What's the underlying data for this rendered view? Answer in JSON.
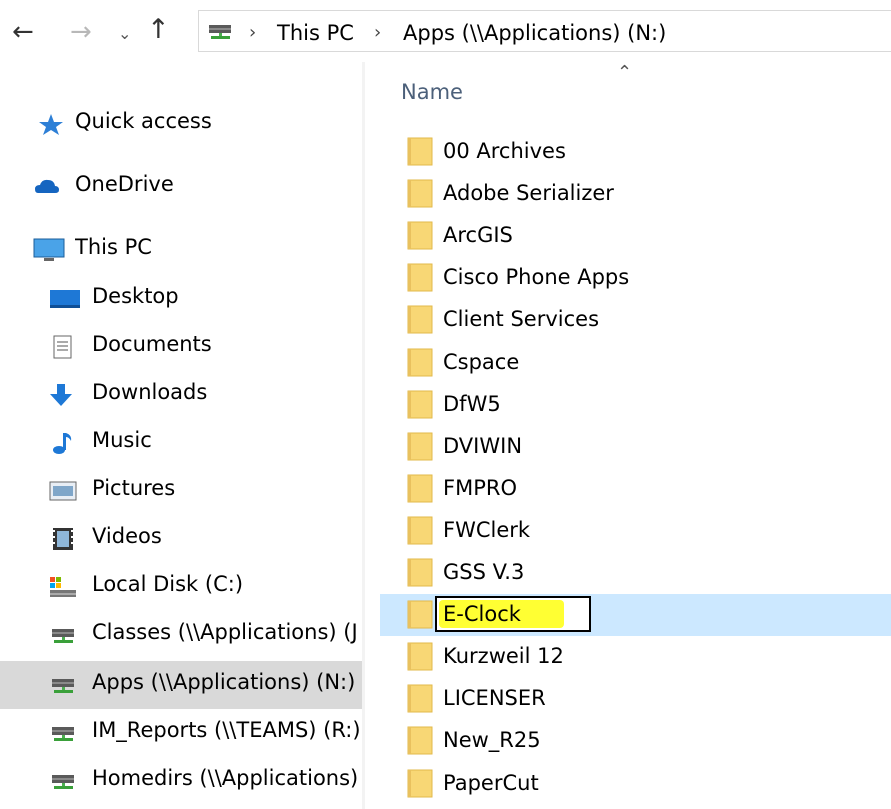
{
  "address_bar": {
    "back_icon": "arrow-left-icon",
    "forward_icon": "arrow-right-icon",
    "recent_icon": "chevron-down-icon",
    "up_icon": "arrow-up-icon",
    "drive_icon": "network-drive-icon",
    "breadcrumbs": [
      "This PC",
      "Apps (\\\\Applications) (N:)"
    ]
  },
  "nav_pane": {
    "items": [
      {
        "label": "Quick access",
        "icon": "star-icon"
      },
      {
        "label": "OneDrive",
        "icon": "cloud-icon"
      },
      {
        "label": "This PC",
        "icon": "computer-icon"
      },
      {
        "label": "Desktop",
        "icon": "desktop-icon"
      },
      {
        "label": "Documents",
        "icon": "document-icon"
      },
      {
        "label": "Downloads",
        "icon": "download-icon"
      },
      {
        "label": "Music",
        "icon": "music-icon"
      },
      {
        "label": "Pictures",
        "icon": "pictures-icon"
      },
      {
        "label": "Videos",
        "icon": "video-icon"
      },
      {
        "label": "Local Disk (C:)",
        "icon": "local-disk-icon"
      },
      {
        "label": "Classes (\\\\Applications) (J:)",
        "icon": "network-drive-icon"
      },
      {
        "label": "Apps (\\\\Applications) (N:)",
        "icon": "network-drive-icon",
        "selected": true
      },
      {
        "label": "IM_Reports (\\\\TEAMS) (R:)",
        "icon": "network-drive-icon"
      },
      {
        "label": "Homedirs (\\\\Applications) (U:)",
        "icon": "network-drive-icon"
      }
    ]
  },
  "content": {
    "column_header": "Name",
    "sort_icon": "caret-up-icon",
    "folders": [
      "00 Archives",
      "Adobe Serializer",
      "ArcGIS",
      "Cisco Phone Apps",
      "Client Services",
      "Cspace",
      "DfW5",
      "DVIWIN",
      "FMPRO",
      "FWClerk",
      "GSS V.3",
      "E-Clock",
      "Kurzweil 12",
      "LICENSER",
      "New_R25",
      "PaperCut"
    ],
    "renaming_folder_index": 11,
    "rename_value": "E-Clock",
    "highlight_color": "#ffff33",
    "selection_color": "#cce8ff"
  }
}
